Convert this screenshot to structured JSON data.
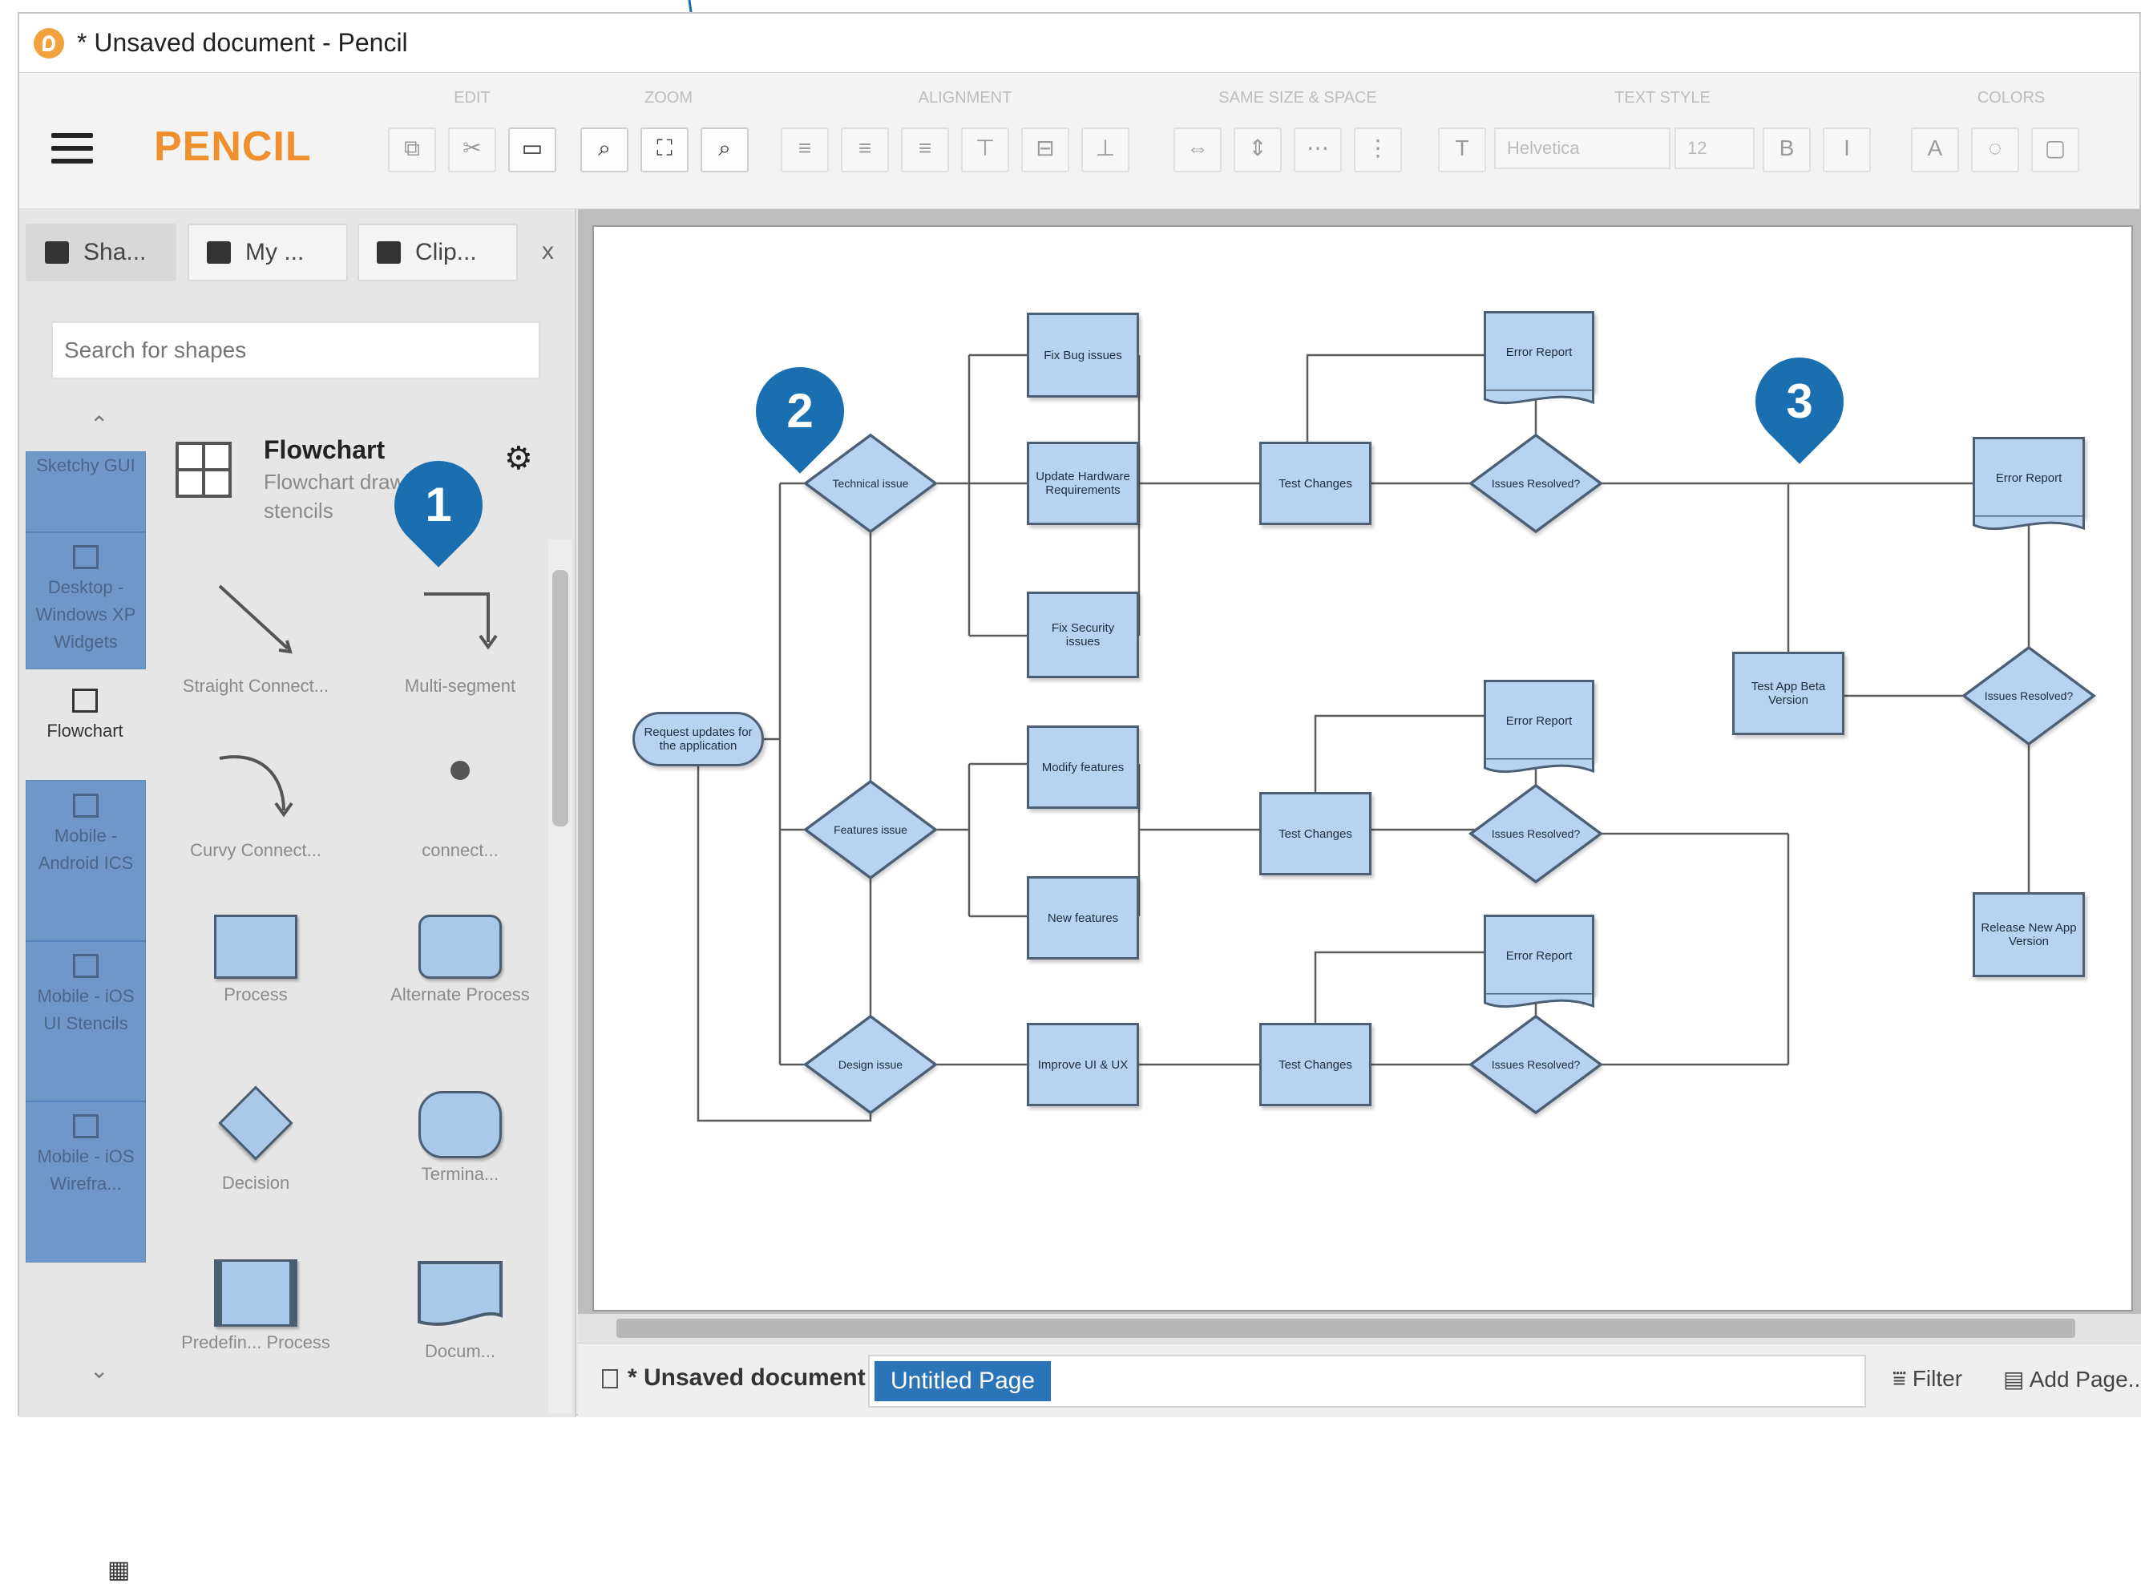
{
  "window": {
    "title": "* Unsaved document - Pencil"
  },
  "toolbar": {
    "brand": "PENCIL",
    "groups": [
      {
        "label": "EDIT"
      },
      {
        "label": "ZOOM"
      },
      {
        "label": "ALIGNMENT"
      },
      {
        "label": "SAME SIZE & SPACE"
      },
      {
        "label": "TEXT STYLE"
      },
      {
        "label": "COLORS"
      }
    ],
    "font_name": "Helvetica",
    "font_size": "12"
  },
  "left_panel": {
    "tabs": [
      {
        "label": "Sha..."
      },
      {
        "label": "My ..."
      },
      {
        "label": "Clip..."
      }
    ],
    "close": "x",
    "search_placeholder": "Search for shapes",
    "categories": [
      {
        "label": "Sketchy GUI"
      },
      {
        "label": "Desktop - Windows XP Widgets"
      },
      {
        "label": "Flowchart"
      },
      {
        "label": "Mobile - Android ICS"
      },
      {
        "label": "Mobile - iOS UI Stencils"
      },
      {
        "label": "Mobile - iOS Wirefra..."
      }
    ],
    "collection": {
      "title": "Flowchart",
      "description": "Flowchart drawing stencils"
    },
    "shapes": [
      {
        "label": "Straight Connect..."
      },
      {
        "label": "Multi-segment"
      },
      {
        "label": "Curvy Connect..."
      },
      {
        "label": "connect..."
      },
      {
        "label": "Process"
      },
      {
        "label": "Alternate Process"
      },
      {
        "label": "Decision"
      },
      {
        "label": "Termina..."
      },
      {
        "label": "Predefin... Process"
      },
      {
        "label": "Docum..."
      }
    ]
  },
  "callouts": [
    "1",
    "2",
    "3"
  ],
  "flowchart": {
    "start": "Request updates for the application",
    "decisions": {
      "technical": "Technical issue",
      "features": "Features issue",
      "design": "Design issue",
      "resolved_1": "Issues Resolved?",
      "resolved_2": "Issues Resolved?",
      "resolved_3": "Issues Resolved?",
      "resolved_final": "Issues Resolved?"
    },
    "processes": {
      "fix_bug": "Fix Bug issues",
      "update_hw": "Update Hardware Requirements",
      "fix_security": "Fix Security issues",
      "modify_features": "Modify features",
      "new_features": "New features",
      "improve_ui": "Improve UI & UX",
      "test_1": "Test Changes",
      "test_2": "Test Changes",
      "test_3": "Test Changes",
      "beta": "Test App Beta Version",
      "release": "Release New App Version"
    },
    "documents": {
      "err_1": "Error Report",
      "err_2": "Error Report",
      "err_3": "Error Report",
      "err_4": "Error Report"
    }
  },
  "statusbar": {
    "document": "* Unsaved document",
    "active_page": "Untitled Page",
    "filter": "Filter",
    "add_page": "Add Page..."
  }
}
